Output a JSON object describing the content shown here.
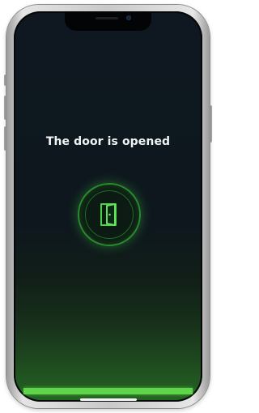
{
  "screen": {
    "status_title": "The door is opened",
    "door_icon": "door-open-icon",
    "progress": 1.0
  },
  "colors": {
    "background_top": "#0f1820",
    "accent_green": "#5fd64a",
    "ring_green": "#2a8a2f",
    "text": "#f2f4f3"
  }
}
